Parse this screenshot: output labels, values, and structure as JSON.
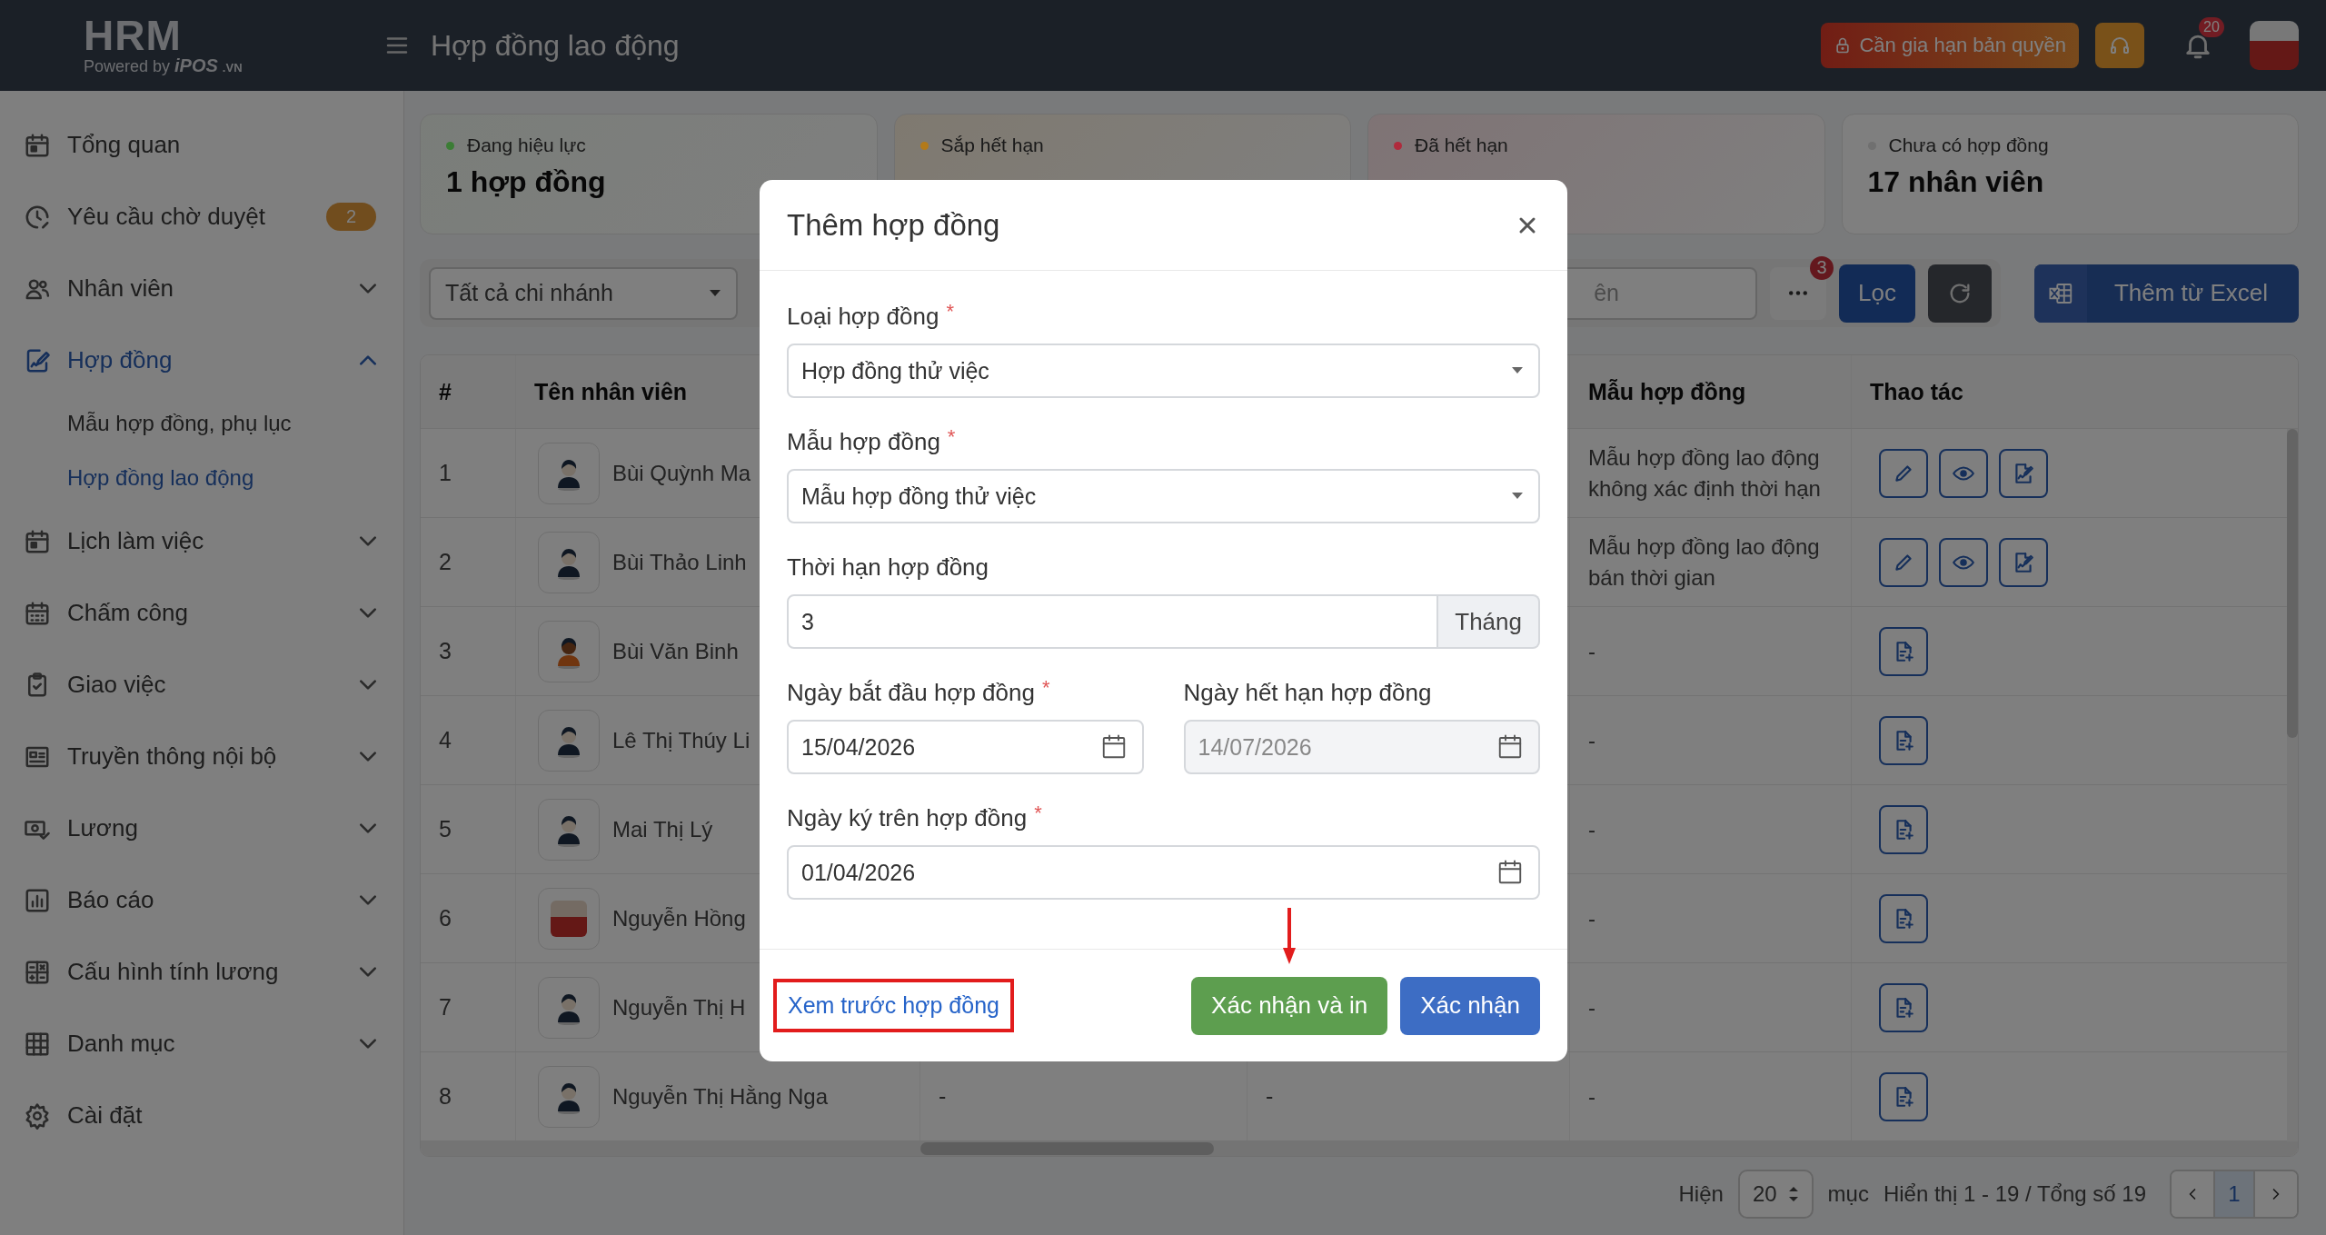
{
  "header": {
    "logo": "HRM",
    "tagline": "Powered by",
    "brand": "iPOS",
    "brand_suffix": ".VN",
    "title": "Hợp đồng lao động",
    "license_button": "Cần gia hạn bản quyền",
    "notification_count": "20"
  },
  "sidebar": {
    "items": [
      {
        "label": "Tổng quan",
        "selected": false
      },
      {
        "label": "Yêu cầu chờ duyệt",
        "selected": false,
        "badge": "2"
      },
      {
        "label": "Nhân viên",
        "selected": false,
        "expanded": false
      },
      {
        "label": "Hợp đồng",
        "selected": true,
        "expanded": true,
        "children": [
          {
            "label": "Mẫu hợp đồng, phụ lục",
            "selected": false
          },
          {
            "label": "Hợp đồng lao động",
            "selected": true
          }
        ]
      },
      {
        "label": "Lịch làm việc",
        "selected": false,
        "expanded": false
      },
      {
        "label": "Chấm công",
        "selected": false,
        "expanded": false
      },
      {
        "label": "Giao việc",
        "selected": false,
        "expanded": false
      },
      {
        "label": "Truyền thông nội bộ",
        "selected": false,
        "expanded": false
      },
      {
        "label": "Lương",
        "selected": false,
        "expanded": false
      },
      {
        "label": "Báo cáo",
        "selected": false,
        "expanded": false
      },
      {
        "label": "Cấu hình tính lương",
        "selected": false,
        "expanded": false
      },
      {
        "label": "Danh mục",
        "selected": false,
        "expanded": false
      },
      {
        "label": "Cài đặt",
        "selected": false
      }
    ]
  },
  "cards": [
    {
      "label": "Đang hiệu lực",
      "color": "#3b7d35",
      "value": "1 hợp đồng"
    },
    {
      "label": "Sắp hết hạn",
      "color": "#b37a1a"
    },
    {
      "label": "Đã hết hạn",
      "color": "#b02a3c"
    },
    {
      "label": "Chưa có hợp đồng",
      "color": "#707070",
      "value": "17 nhân viên"
    }
  ],
  "filters": {
    "branch_select": "Tất cả chi nhánh",
    "search": {
      "placeholder": "ên"
    },
    "more_badge": "3",
    "filter_button": "Lọc",
    "import_button": "Thêm từ Excel"
  },
  "table": {
    "columns": [
      "#",
      "Tên nhân viên",
      "Mẫu hợp đồng",
      "Thao tác"
    ],
    "rows": [
      {
        "index": "1",
        "avatar": {
          "kind": "silhouette"
        },
        "name": "Bùi Quỳnh Ma",
        "template": "Mẫu hợp đồng lao động không xác định thời hạn",
        "actions": [
          {
            "kind": "edit"
          },
          {
            "kind": "view"
          },
          {
            "kind": "sign"
          }
        ]
      },
      {
        "index": "2",
        "avatar": {
          "kind": "silhouette"
        },
        "name": "Bùi Thảo Linh",
        "template": "Mẫu hợp đồng lao động bán thời gian",
        "actions": [
          {
            "kind": "edit"
          },
          {
            "kind": "view"
          },
          {
            "kind": "sign"
          }
        ]
      },
      {
        "index": "3",
        "avatar": {
          "kind": "orange"
        },
        "name": "Bùi Văn Binh",
        "template": "-",
        "actions": [
          {
            "kind": "add"
          }
        ]
      },
      {
        "index": "4",
        "avatar": {
          "kind": "silhouette"
        },
        "name": "Lê Thị Thúy Li",
        "template": "-",
        "actions": [
          {
            "kind": "add"
          }
        ]
      },
      {
        "index": "5",
        "avatar": {
          "kind": "silhouette"
        },
        "name": "Mai Thị Lý",
        "template": "-",
        "actions": [
          {
            "kind": "add"
          }
        ]
      },
      {
        "index": "6",
        "avatar": {
          "kind": "photo"
        },
        "name": "Nguyễn Hồng",
        "template": "-",
        "actions": [
          {
            "kind": "add"
          }
        ]
      },
      {
        "index": "7",
        "avatar": {
          "kind": "silhouette"
        },
        "name": "Nguyễn Thị H",
        "template": "-",
        "actions": [
          {
            "kind": "add"
          }
        ]
      },
      {
        "index": "8",
        "avatar": {
          "kind": "silhouette"
        },
        "name": "Nguyễn Thị Hằng Nga",
        "column_3": "-",
        "column_4": "-",
        "template": "-",
        "actions": [
          {
            "kind": "add"
          }
        ]
      }
    ]
  },
  "pagination": {
    "show_label": "Hiện",
    "page_size": "20",
    "unit": "mục",
    "summary": "Hiển thị 1 - 19 / Tổng số 19",
    "pages": [
      {
        "label": "1",
        "selected": true
      }
    ]
  },
  "modal": {
    "title": "Thêm hợp đồng",
    "rows": [
      [
        {
          "kind": "select",
          "label": "Loại hợp đồng",
          "required_mark": "*",
          "value": "Hợp đồng thử việc"
        }
      ],
      [
        {
          "kind": "select",
          "label": "Mẫu hợp đồng",
          "required_mark": "*",
          "value": "Mẫu hợp đồng thử việc"
        }
      ],
      [
        {
          "kind": "number",
          "label": "Thời hạn hợp đồng",
          "value": "3",
          "unit": "Tháng"
        }
      ],
      [
        {
          "kind": "date",
          "label": "Ngày bắt đầu hợp đồng",
          "required_mark": "*",
          "value": "15/04/2026",
          "disabled": false
        },
        {
          "kind": "date",
          "label": "Ngày hết hạn hợp đồng",
          "value": "14/07/2026",
          "disabled": true
        }
      ],
      [
        {
          "kind": "date",
          "label": "Ngày ký trên hợp đồng",
          "required_mark": "*",
          "value": "01/04/2026",
          "disabled": false
        }
      ]
    ],
    "preview_link": {
      "label": "Xem trước hợp đồng",
      "highlighted": true
    },
    "buttons": [
      {
        "kind": "success",
        "label": "Xác nhận và in",
        "pointed": true
      },
      {
        "kind": "primary",
        "label": "Xác nhận",
        "pointed": false
      }
    ]
  }
}
